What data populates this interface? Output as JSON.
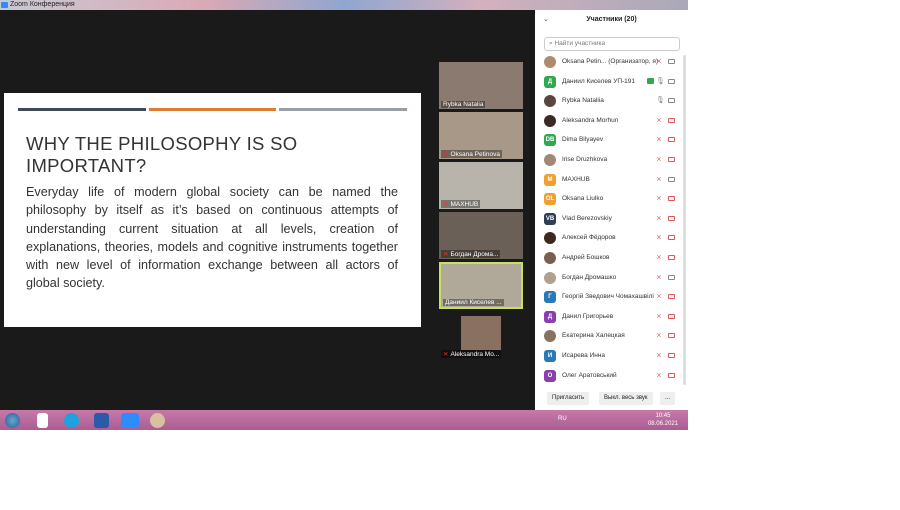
{
  "window": {
    "title": "Zoom Конференция"
  },
  "slide": {
    "colors": [
      "#3f4a55",
      "#e07b36",
      "#9a9fa5"
    ],
    "title": "WHY  THE PHILOSOPHY IS SO IMPORTANT?",
    "body": "Everyday life of modern global society can be named the philosophy by itself as it’s based on continuous attempts of understanding current situation at all levels, creation of explanations, theories, models and cognitive instruments together with new level of information exchange between all actors of global society."
  },
  "videos": [
    {
      "name": "Rybka Natalia",
      "muted": false,
      "active": false
    },
    {
      "name": "Oksana Petinova",
      "muted": true,
      "active": false
    },
    {
      "name": "MAXHUB",
      "muted": true,
      "active": false
    },
    {
      "name": "Богдан Дрома...",
      "muted": true,
      "active": false
    },
    {
      "name": "Даниил Киселев ...",
      "muted": false,
      "active": true
    },
    {
      "name": "Aleksandra Mo...",
      "muted": true,
      "active": false
    }
  ],
  "participants": {
    "title": "Участники (20)",
    "search_placeholder": "Найти участника",
    "list": [
      {
        "name": "Oksana Petin...   (Организатор, я)",
        "avatar": "",
        "color": "#b08a70",
        "mic": "off",
        "cam": "on"
      },
      {
        "name": "Даниил Киселев УП-191",
        "avatar": "Д",
        "color": "#2fa84f",
        "mic": "on",
        "cam": "on"
      },
      {
        "name": "Rybka Nataliia",
        "avatar": "",
        "color": "#5a4540",
        "mic": "on",
        "cam": "on"
      },
      {
        "name": "Aleksandra Morhun",
        "avatar": "",
        "color": "#3a2a25",
        "mic": "off",
        "cam": "off"
      },
      {
        "name": "Dima Bilyayev",
        "avatar": "DB",
        "color": "#2fa84f",
        "mic": "off",
        "cam": "off"
      },
      {
        "name": "Irise Druzhkova",
        "avatar": "",
        "color": "#a08878",
        "mic": "off",
        "cam": "off"
      },
      {
        "name": "MAXHUB",
        "avatar": "M",
        "color": "#f0a030",
        "mic": "off",
        "cam": "on"
      },
      {
        "name": "Oksana Liulko",
        "avatar": "OL",
        "color": "#f0a030",
        "mic": "off",
        "cam": "off"
      },
      {
        "name": "Vlad Berezovskiy",
        "avatar": "VB",
        "color": "#2e3e55",
        "mic": "off",
        "cam": "off"
      },
      {
        "name": "Алексей Фёдоров",
        "avatar": "",
        "color": "#3a2a20",
        "mic": "off",
        "cam": "off"
      },
      {
        "name": "Андрей Бошков",
        "avatar": "",
        "color": "#7a6050",
        "mic": "off",
        "cam": "off"
      },
      {
        "name": "Богдан Дромашко",
        "avatar": "",
        "color": "#b0a090",
        "mic": "off",
        "cam": "on"
      },
      {
        "name": "Георгій Зведович Чомахашвілі",
        "avatar": "Г",
        "color": "#2a7ab8",
        "mic": "off",
        "cam": "off"
      },
      {
        "name": "Данил Григорьев",
        "avatar": "Д",
        "color": "#8a3fb0",
        "mic": "off",
        "cam": "off"
      },
      {
        "name": "Екатерина Халецкая",
        "avatar": "",
        "color": "#8a7060",
        "mic": "off",
        "cam": "off"
      },
      {
        "name": "Исарева Инна",
        "avatar": "И",
        "color": "#2a7ab8",
        "mic": "off",
        "cam": "off"
      },
      {
        "name": "Олег Аратовський",
        "avatar": "О",
        "color": "#8a3fb0",
        "mic": "off",
        "cam": "off"
      }
    ],
    "invite": "Пригласить",
    "mute_all": "Выкл. весь звук",
    "more": "..."
  },
  "taskbar": {
    "lang": "RU",
    "time": "10:45",
    "date": "08.06.2021"
  }
}
